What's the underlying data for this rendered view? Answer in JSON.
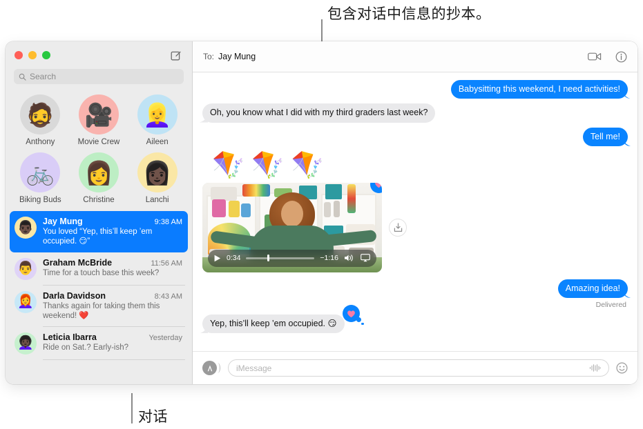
{
  "annotations": [
    {
      "id": "transcript",
      "text": "包含对话中信息的抄本。"
    },
    {
      "id": "conversations",
      "text": "对话"
    }
  ],
  "window": {
    "traffic_lights": [
      "close-button",
      "minimize-button",
      "zoom-button"
    ],
    "compose_icon": "compose-icon"
  },
  "sidebar": {
    "search": {
      "placeholder": "Search",
      "icon": "search-icon"
    },
    "pinned": [
      {
        "name": "Anthony",
        "emoji": "🧔",
        "bg": "#d9d9d9"
      },
      {
        "name": "Movie Crew",
        "emoji": "🎥",
        "bg": "#f9b3ae"
      },
      {
        "name": "Aileen",
        "emoji": "👱‍♀️",
        "bg": "#bfe3f5"
      },
      {
        "name": "Biking Buds",
        "emoji": "🚲",
        "bg": "#d9cdf7"
      },
      {
        "name": "Christine",
        "emoji": "👩",
        "bg": "#bdeec4"
      },
      {
        "name": "Lanchi",
        "emoji": "👩🏿",
        "bg": "#fae7a6"
      }
    ],
    "conversations": [
      {
        "name": "Jay Mung",
        "time": "9:38 AM",
        "preview": "You loved “Yep, this’ll keep ’em occupied. 😏”",
        "emoji": "👨🏿",
        "bg": "#fae7a6",
        "selected": true
      },
      {
        "name": "Graham McBride",
        "time": "11:56 AM",
        "preview": "Time for a touch base this week?",
        "emoji": "👨",
        "bg": "#dfd3f7",
        "selected": false
      },
      {
        "name": "Darla Davidson",
        "time": "8:43 AM",
        "preview": "Thanks again for taking them this weekend! ❤️",
        "emoji": "👩🦰",
        "bg": "#c7e8f7",
        "selected": false
      },
      {
        "name": "Leticia Ibarra",
        "time": "Yesterday",
        "preview": "Ride on Sat.? Early-ish?",
        "emoji": "👩🏿‍🦱",
        "bg": "#c6f0ce",
        "selected": false
      }
    ]
  },
  "chat": {
    "to_label": "To:",
    "to_name": "Jay Mung",
    "facetime_icon": "video-camera-icon",
    "details_icon": "info-icon",
    "messages": [
      {
        "type": "text",
        "direction": "out",
        "text": "Babysitting this weekend, I need activities!"
      },
      {
        "type": "text",
        "direction": "in",
        "text": "Oh, you know what I did with my third graders last week?"
      },
      {
        "type": "text",
        "direction": "out",
        "text": "Tell me!"
      },
      {
        "type": "sticker",
        "direction": "in",
        "text": "🪁🪁🪁"
      },
      {
        "type": "video",
        "direction": "in",
        "tapback": "heart"
      },
      {
        "type": "text",
        "direction": "out",
        "text": "Amazing idea!",
        "status": "Delivered"
      },
      {
        "type": "text",
        "direction": "in",
        "text": "Yep, this’ll keep ’em occupied. 😏",
        "tapback": "heart"
      }
    ],
    "video": {
      "play_icon": "play-icon",
      "elapsed": "0:34",
      "remaining": "−1:16",
      "volume_icon": "volume-icon",
      "airplay_icon": "airplay-icon",
      "download_icon": "download-icon",
      "progress_percent": 31
    },
    "compose": {
      "apps_icon": "app-store-icon",
      "placeholder": "iMessage",
      "value": "",
      "audio_icon": "audio-waveform-icon",
      "emoji_icon": "emoji-smiley-icon"
    }
  },
  "colors": {
    "accent_blue": "#0a84ff",
    "selected_blue": "#0a7cff",
    "incoming_gray": "#e9e9eb",
    "sidebar_bg": "#ececec"
  }
}
